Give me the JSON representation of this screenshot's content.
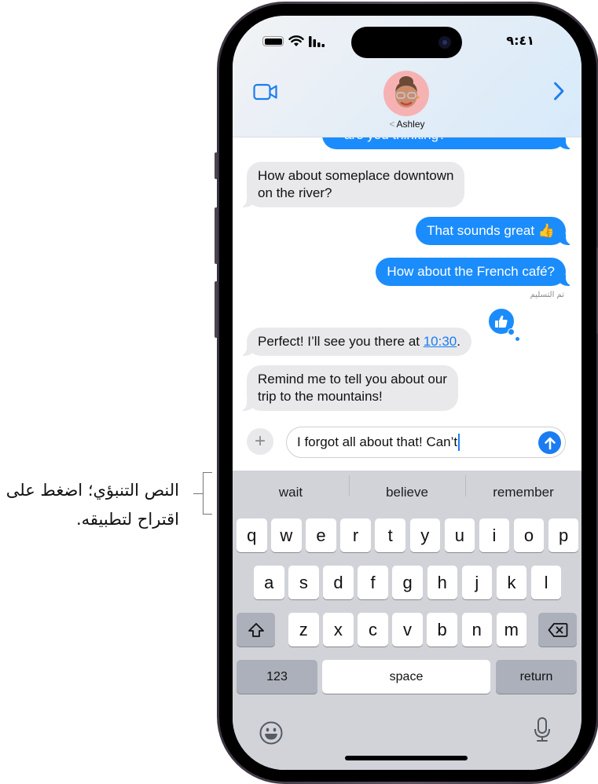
{
  "callout": {
    "text": "النص التنبؤي؛ اضغط على اقتراح لتطبيقه."
  },
  "status_bar": {
    "time": "٩:٤١",
    "icons": [
      "battery-icon",
      "wifi-icon",
      "cellular-signal-icon"
    ]
  },
  "header": {
    "contact_name": "Ashley",
    "back_glyph": "<",
    "video_icon": "video-camera-icon",
    "details_icon": "chevron-right-icon"
  },
  "messages": [
    {
      "direction": "outgoing",
      "text": "are you thinking?",
      "partial": true
    },
    {
      "direction": "incoming",
      "text_lines": [
        "How about someplace downtown",
        "on the river?"
      ]
    },
    {
      "direction": "outgoing",
      "text": "That sounds great",
      "emoji": "👍"
    },
    {
      "direction": "outgoing",
      "text": "How about the French café?"
    },
    {
      "direction": "incoming",
      "text_before": "Perfect! I’ll see you there at ",
      "link": "10:30",
      "text_after": ".",
      "tapback": "thumbs-up-icon"
    },
    {
      "direction": "incoming",
      "text_lines": [
        "Remind me to tell you about our",
        "trip to the mountains!"
      ]
    }
  ],
  "delivered_label": "تم التسليم",
  "composer": {
    "plus_glyph": "+",
    "value": "I forgot all about that! Can’t",
    "send_icon": "arrow-up-icon"
  },
  "keyboard": {
    "suggestions": [
      "wait",
      "believe",
      "remember"
    ],
    "row1": [
      "q",
      "w",
      "e",
      "r",
      "t",
      "y",
      "u",
      "i",
      "o",
      "p"
    ],
    "row2": [
      "a",
      "s",
      "d",
      "f",
      "g",
      "h",
      "j",
      "k",
      "l"
    ],
    "row3": [
      "z",
      "x",
      "c",
      "v",
      "b",
      "n",
      "m"
    ],
    "numbers_label": "123",
    "space_label": "space",
    "return_label": "return",
    "shift_icon": "shift-icon",
    "delete_icon": "delete-icon",
    "emoji_icon": "emoji-icon",
    "mic_icon": "microphone-icon"
  },
  "colors": {
    "accent_blue": "#1b8cfb",
    "incoming_bubble": "#e9e9eb",
    "keyboard_bg": "#d1d3d9"
  }
}
